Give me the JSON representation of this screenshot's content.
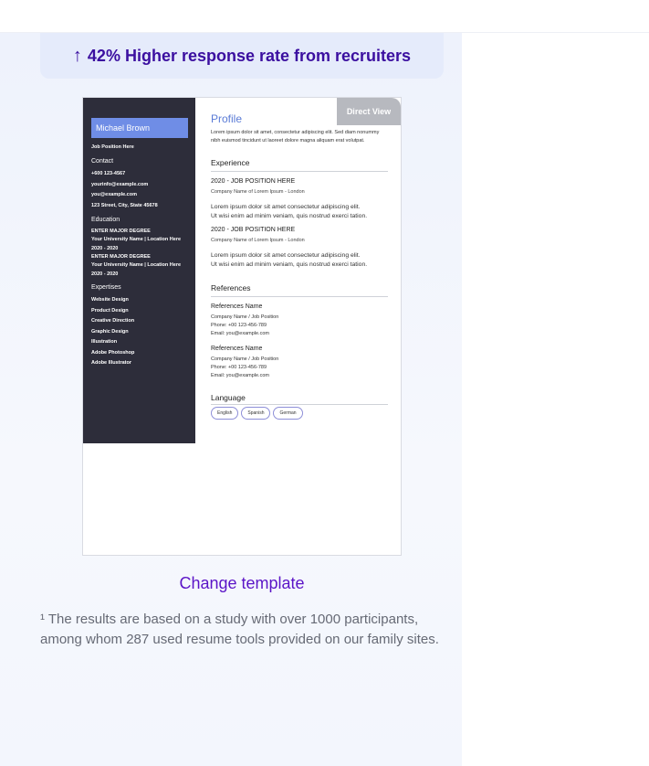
{
  "banner": {
    "arrow": "↑",
    "text": "42% Higher response rate from recruiters"
  },
  "resume": {
    "direct_view": "Direct View",
    "sidebar": {
      "name": "Michael Brown",
      "job_position": "Job Position Here",
      "contact_title": "Contact",
      "contact_lines": [
        "+600 123-4567",
        "yourinfo@example.com",
        "you@example.com",
        "123 Street, City, State 45678"
      ],
      "education_title": "Education",
      "education": [
        {
          "degree": "ENTER MAJOR DEGREE",
          "school": "Your University Name | Location Here",
          "years": "2020 - 2020"
        },
        {
          "degree": "ENTER MAJOR DEGREE",
          "school": "Your University Name | Location Here",
          "years": "2020 - 2020"
        }
      ],
      "expertises_title": "Expertises",
      "expertises": [
        "Website Design",
        "Product Design",
        "Creative Direction",
        "Graphic Design",
        "Illustration",
        "Adobe Photoshop",
        "Adobe Illustrator"
      ]
    },
    "main": {
      "profile_title": "Profile",
      "profile_text": "Lorem ipsum dolor sit amet, consectetur adipiscing elit. Sed diam nonummy nibh euismod tincidunt ut laoreet dolore magna aliquam erat volutpat.",
      "experience_title": "Experience",
      "experience": [
        {
          "title": "2020 - JOB POSITION HERE",
          "company": "Company Name of Lorem Ipsum - London",
          "desc1": "Lorem ipsum dolor sit amet consectetur adipiscing elit.",
          "desc2": "Ut wisi enim ad minim veniam, quis nostrud exerci tation."
        },
        {
          "title": "2020 - JOB POSITION HERE",
          "company": "Company Name of Lorem Ipsum - London",
          "desc1": "Lorem ipsum dolor sit amet consectetur adipiscing elit.",
          "desc2": "Ut wisi enim ad minim veniam, quis nostrud exerci tation."
        }
      ],
      "references_title": "References",
      "references": [
        {
          "name": "References Name",
          "company": "Company Name / Job Position",
          "phone": "Phone: +00 123-456-789",
          "email": "Email: you@example.com"
        },
        {
          "name": "References Name",
          "company": "Company Name / Job Position",
          "phone": "Phone: +00 123-456-789",
          "email": "Email: you@example.com"
        }
      ],
      "language_title": "Language",
      "languages": [
        "English",
        "Spanish",
        "German"
      ]
    }
  },
  "change_template": "Change template",
  "footnote": "¹ The results are based on a study with over 1000 participants, among whom 287 used resume tools provided on our family sites."
}
